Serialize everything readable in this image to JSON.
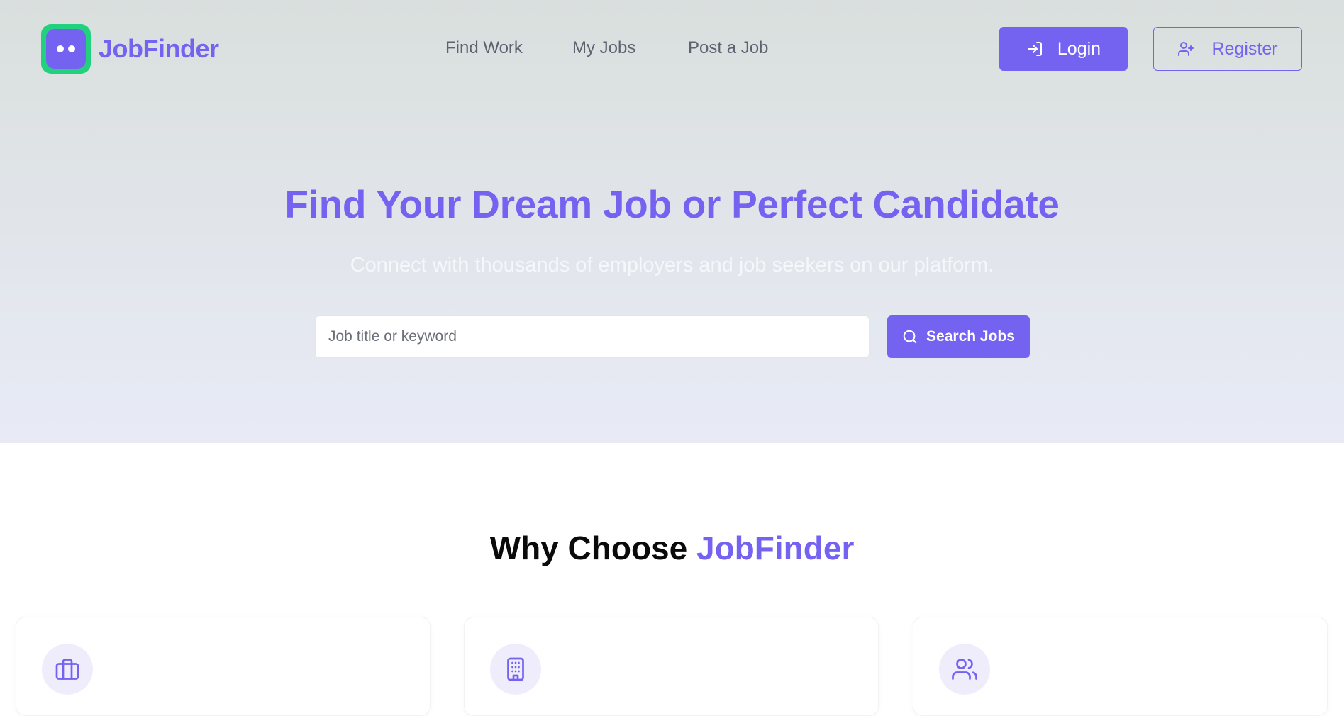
{
  "header": {
    "brand": "JobFinder",
    "nav": {
      "find_work": "Find Work",
      "my_jobs": "My Jobs",
      "post_job": "Post a Job"
    },
    "login_label": "Login",
    "register_label": "Register"
  },
  "hero": {
    "title": "Find Your Dream Job or Perfect Candidate",
    "subtitle": "Connect with thousands of employers and job seekers on our platform.",
    "search": {
      "placeholder": "Job title or keyword",
      "value": "",
      "button_label": "Search Jobs"
    }
  },
  "features": {
    "title_prefix": "Why Choose ",
    "title_accent": "JobFinder",
    "cards": [
      {
        "icon": "briefcase-icon"
      },
      {
        "icon": "building-icon"
      },
      {
        "icon": "users-icon"
      }
    ]
  },
  "colors": {
    "accent": "#7463f0",
    "logo_frame": "#22d07e",
    "nav_text": "#5b6270",
    "icon_bg": "#efedfc"
  }
}
